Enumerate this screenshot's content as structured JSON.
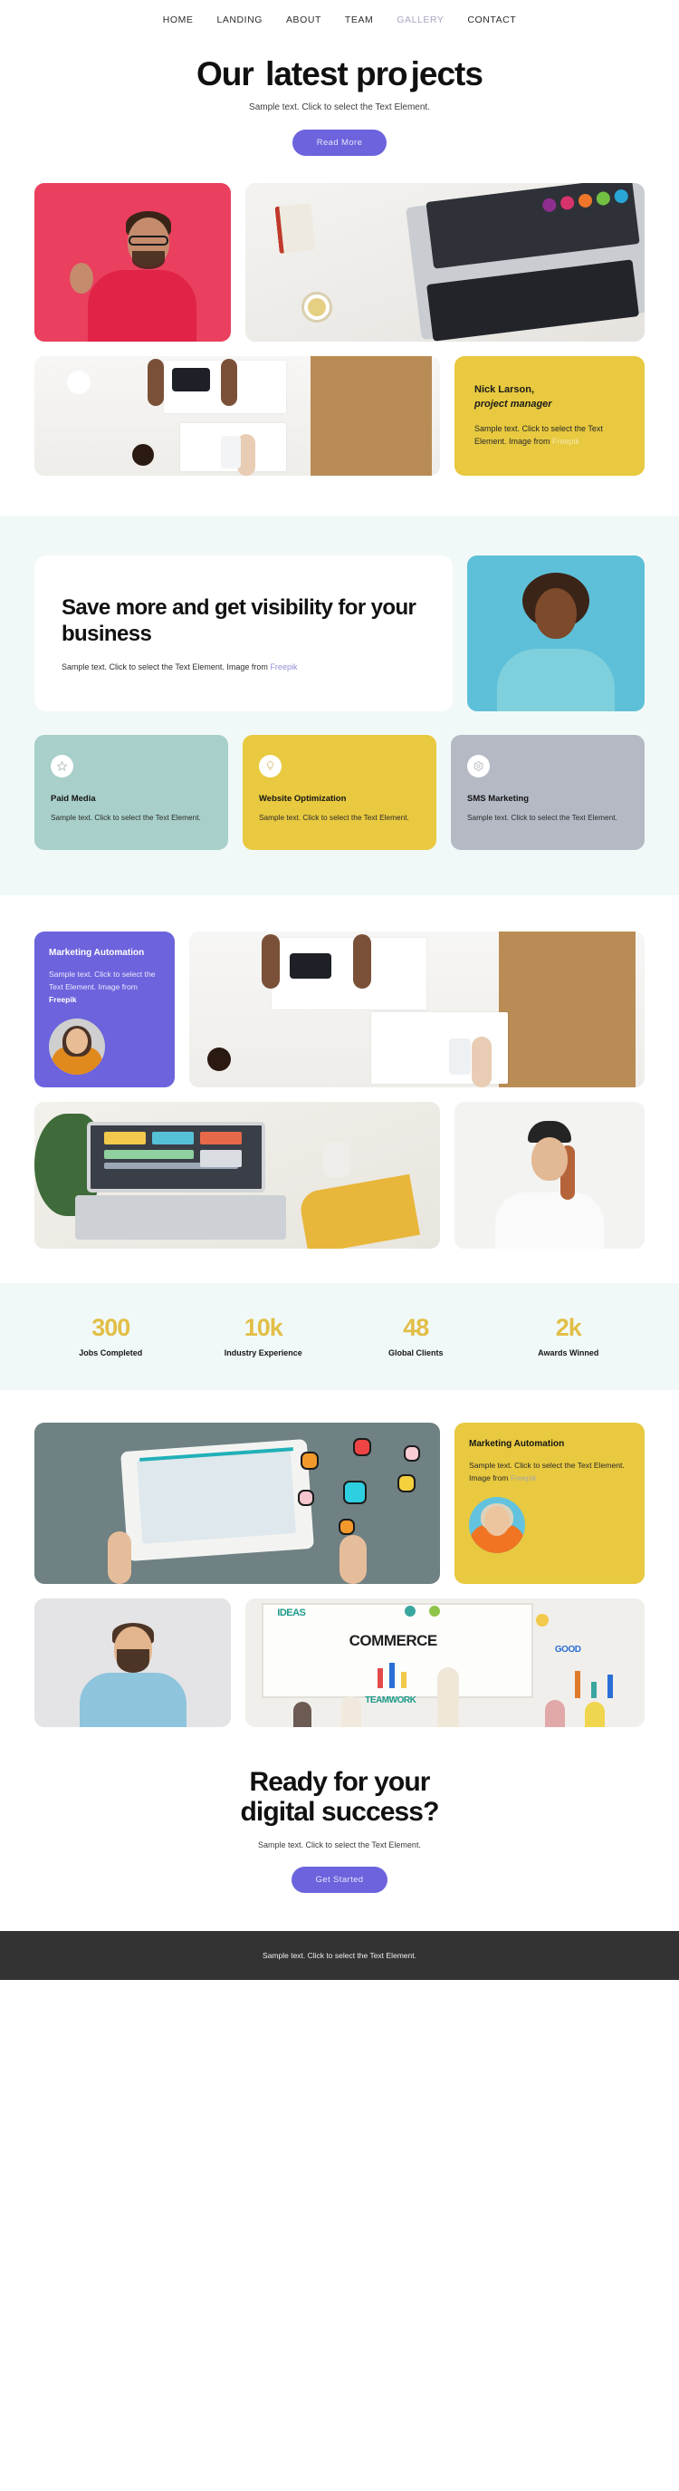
{
  "nav": {
    "items": [
      {
        "label": "HOME",
        "active": false
      },
      {
        "label": "LANDING",
        "active": false
      },
      {
        "label": "ABOUT",
        "active": false
      },
      {
        "label": "TEAM",
        "active": false
      },
      {
        "label": "GALLERY",
        "active": true
      },
      {
        "label": "CONTACT",
        "active": false
      }
    ]
  },
  "hero": {
    "title_part1": "Our ",
    "title_highlight": "latest pro",
    "title_part2": "jects",
    "subtitle": "Sample text. Click to select the Text Element.",
    "button_label": "Read More"
  },
  "gallery1": {
    "person_card": {
      "name": "Nick Larson,",
      "role": "project manager",
      "body": "Sample text. Click to select the Text Element. Image from ",
      "link": "Freepik"
    }
  },
  "feature": {
    "title": "Save more and get visibility for your business",
    "body": "Sample text. Click to select the Text Element. Image from ",
    "link": "Freepik"
  },
  "services": [
    {
      "title": "Paid Media",
      "body": "Sample text. Click to select the Text Element.",
      "icon": "star-icon",
      "bg": "#a8cfc9"
    },
    {
      "title": "Website Optimization",
      "body": "Sample text. Click to select the Text Element.",
      "icon": "lightbulb-icon",
      "bg": "#e8c93f"
    },
    {
      "title": "SMS Marketing",
      "body": "Sample text. Click to select the Text Element.",
      "icon": "gear-icon",
      "bg": "#b5b9c4"
    }
  ],
  "promo_purple": {
    "title": "Marketing Automation",
    "body_start": "Sample text. Click to select the Text Element. Image from ",
    "link": "Freepik"
  },
  "promo_yellow": {
    "title": "Marketing Automation",
    "body_start": "Sample text. Click to select the Text Element. Image from ",
    "link": "Freepik"
  },
  "stats": [
    {
      "number": "300",
      "label": "Jobs Completed"
    },
    {
      "number": "10k",
      "label": "Industry Experience"
    },
    {
      "number": "48",
      "label": "Global Clients"
    },
    {
      "number": "2k",
      "label": "Awards Winned"
    }
  ],
  "cta": {
    "line1_highlight": "Ready for your",
    "line2": "digital success?",
    "subtitle": "Sample text. Click to select the Text Element.",
    "button_label": "Get Started"
  },
  "footer": {
    "text": "Sample text. Click to select the Text Element."
  },
  "images": {
    "img_ok_man": "man-ok-gesture-pink-background",
    "img_laptop_desk": "laptop-marketing-icons-desk",
    "img_meeting_phones": "team-meeting-phones-top-view",
    "img_woman_teal": "smiling-woman-teal-background",
    "img_meeting_phones_2": "team-meeting-phones-top-view",
    "img_dashboard": "laptop-dashboard-desk",
    "img_woman_white": "woman-white-tshirt-beanie",
    "img_digital_media": "tablet-digital-media-icons",
    "img_bearded_man": "bearded-man-blue-polo",
    "img_commerce_board": "commerce-whiteboard-presentation",
    "avatar_purple": "woman-orange-top-grey-circle",
    "avatar_yellow": "woman-orange-sweater-blue-circle"
  },
  "colors": {
    "accent_purple": "#6c63dd",
    "accent_yellow": "#e8c93f",
    "accent_teal": "#aad7d1",
    "section_bg_teal": "#f1f9f8",
    "footer_bg": "#333333",
    "stat_number": "#e2be46"
  }
}
